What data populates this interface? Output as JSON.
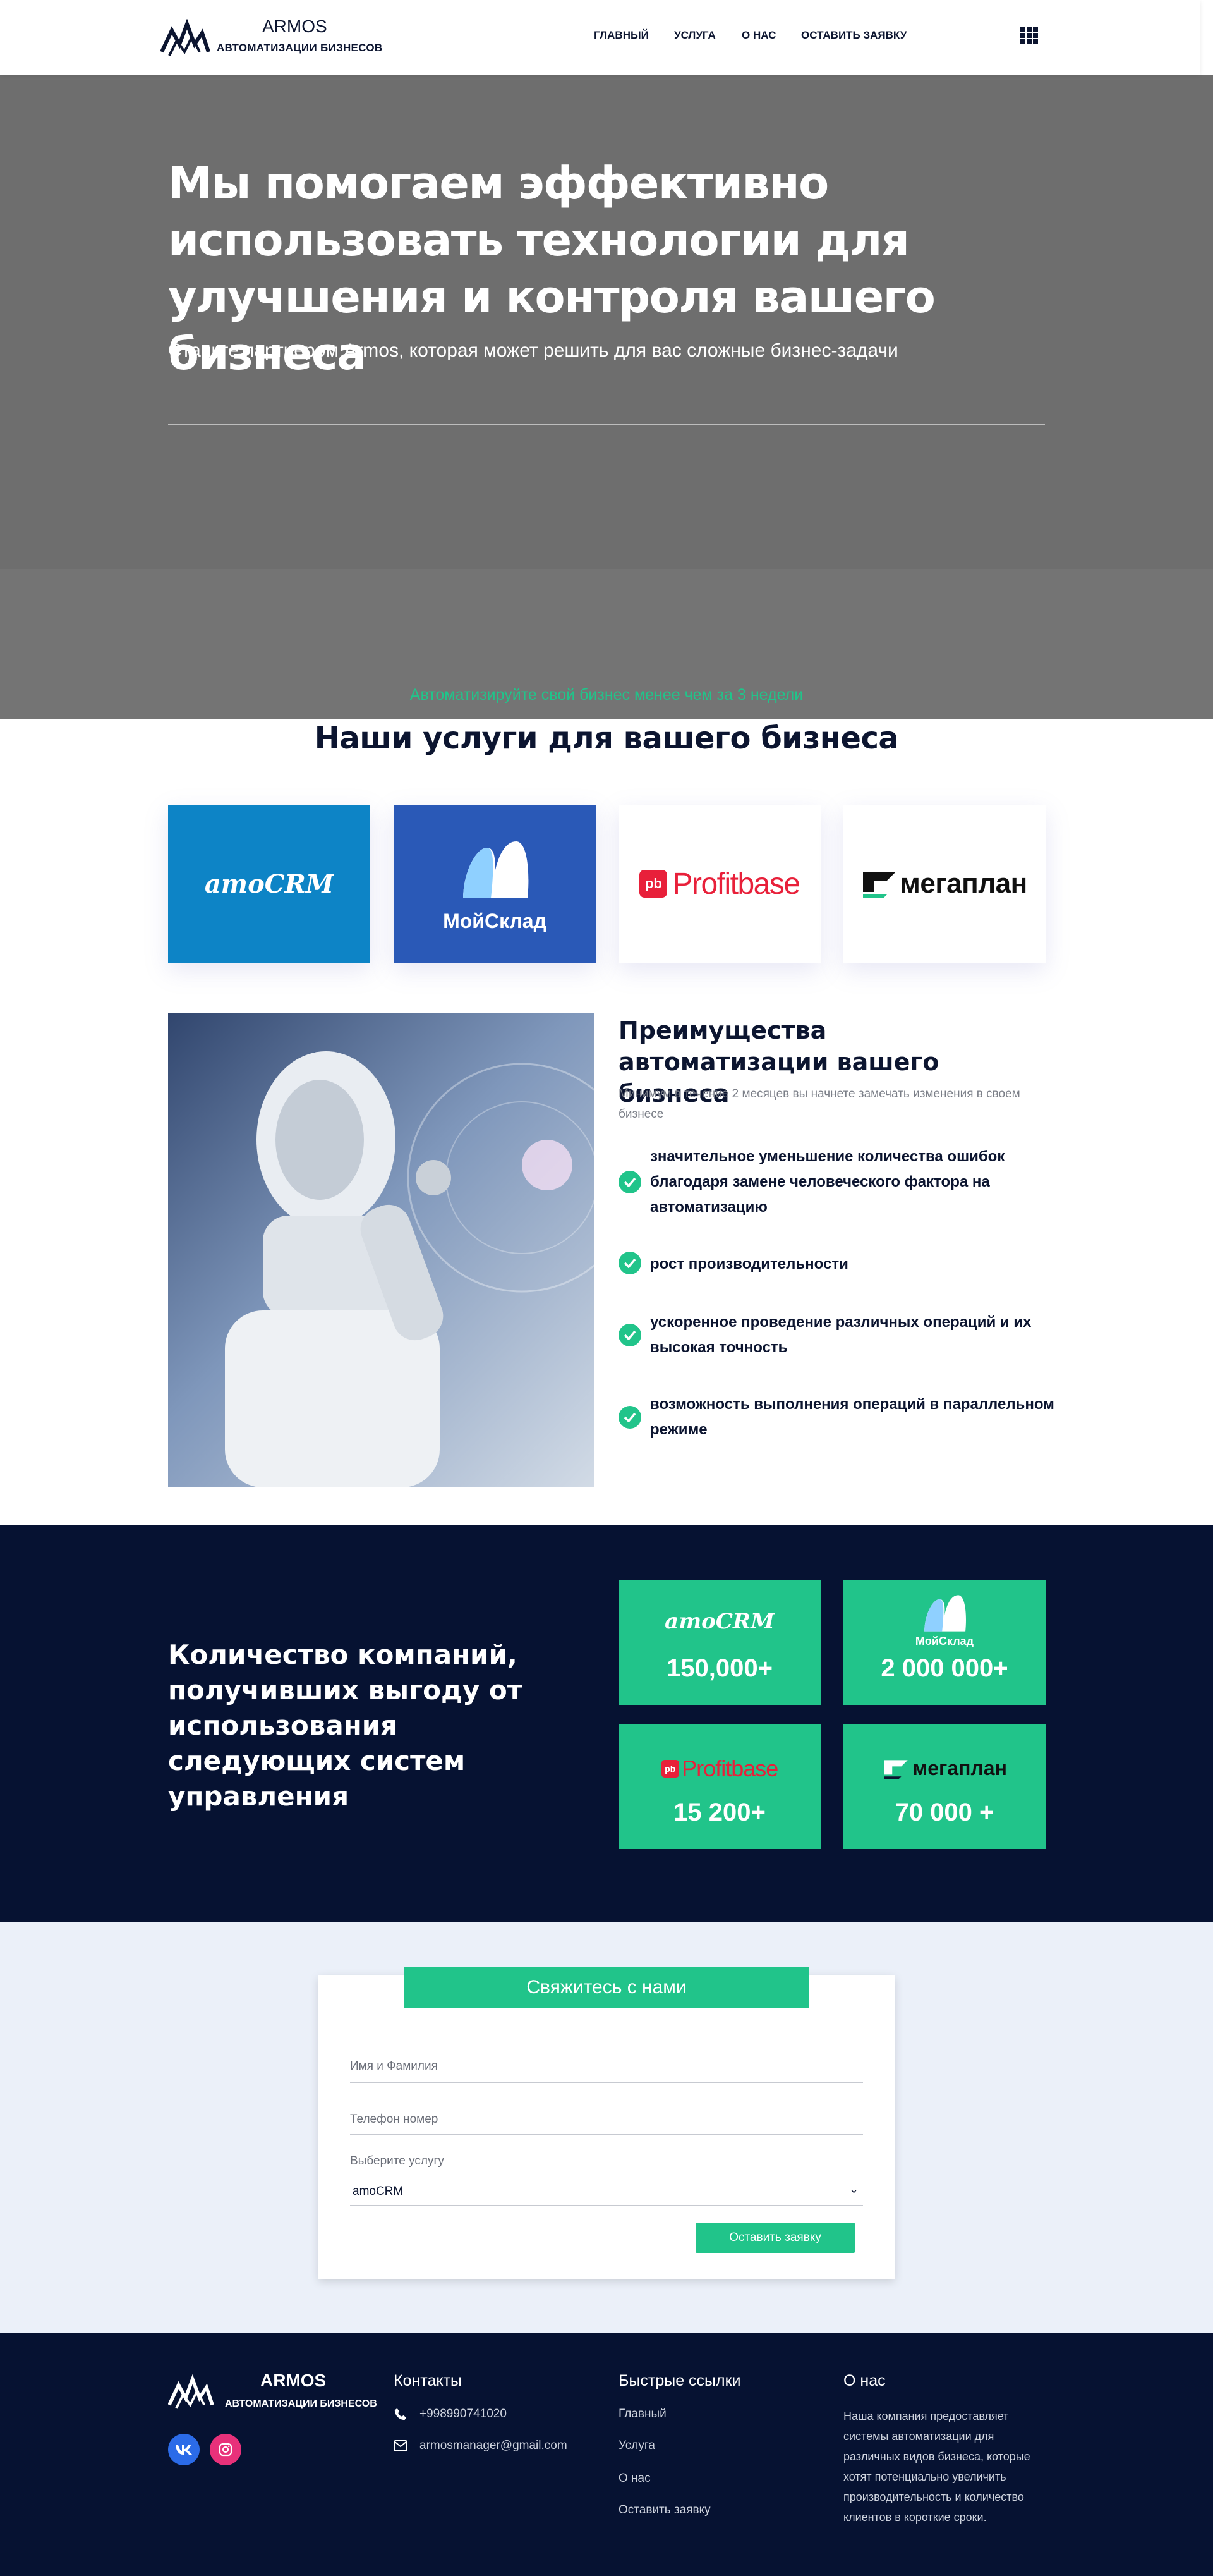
{
  "header": {
    "logo_name": "ARMOS",
    "logo_sub": "АВТОМАТИЗАЦИИ БИЗНЕСОВ",
    "nav": [
      "ГЛАВНЫЙ",
      "УСЛУГА",
      "О НАС",
      "ОСТАВИТЬ ЗАЯВКУ"
    ],
    "menu_icon": "grid-icon"
  },
  "hero": {
    "title": "Мы помогаем эффективно использовать технологии для улучшения и контроля вашего бизнеса",
    "subtitle": "Станьте партнером Armos, которая может решить для вас сложные бизнес-задачи"
  },
  "services": {
    "kicker": "Автоматизируйте свой бизнес менее чем за 3 недели",
    "title": "Наши услуги для вашего бизнеса",
    "cards": [
      {
        "name": "amoCRM",
        "color": "#0d84c6"
      },
      {
        "name": "МойСклад",
        "color": "#2a59b7"
      },
      {
        "name": "Profitbase",
        "badge": "pb",
        "color": "#e8203a"
      },
      {
        "name": "мегаплан",
        "color": "#111111"
      }
    ]
  },
  "benefits": {
    "title": "Преимущества автоматизации вашего бизнеса",
    "subtitle": "Минимум в течение 2 месяцев вы начнете замечать изменения в своем бизнесе",
    "items": [
      "значительное уменьшение количества ошибок благодаря замене человеческого фактора на автоматизацию",
      "рост производительности",
      "ускоренное проведение различных операций и их высокая точность",
      "возможность выполнения операций в параллельном режиме"
    ]
  },
  "stats": {
    "title": "Количество компаний, получивших выгоду от использования следующих систем управления",
    "items": [
      {
        "logo": "amoCRM",
        "value": "150,000+"
      },
      {
        "logo": "МойСклад",
        "value": "2 000 000+"
      },
      {
        "logo": "Profitbase",
        "badge": "pb",
        "value": "15 200+"
      },
      {
        "logo": "мегаплан",
        "value": "70 000 +"
      }
    ]
  },
  "contact": {
    "title": "Свяжитесь с нами",
    "name_placeholder": "Имя и Фамилия",
    "phone_placeholder": "Телефон номер",
    "service_label": "Выберите услугу",
    "service_value": "amoCRM",
    "submit": "Оставить заявку"
  },
  "footer": {
    "logo_name": "ARMOS",
    "logo_sub": "АВТОМАТИЗАЦИИ БИЗНЕСОВ",
    "social": [
      {
        "label": "VK",
        "icon": "vk-icon",
        "color": "#2b6be8"
      },
      {
        "label": "Instagram",
        "icon": "instagram-icon",
        "color": "#e8317a"
      }
    ],
    "contacts_title": "Контакты",
    "phone": "+998990741020",
    "email": "armosmanager@gmail.com",
    "links_title": "Быстрые ссылки",
    "links": [
      "Главный",
      "Услуга",
      "О нас",
      "Оставить заявку"
    ],
    "about_title": "О нас",
    "about_text": "Наша компания предоставляет системы автоматизации для различных видов бизнеса, которые хотят потенциально увеличить производительность и количество клиентов в короткие сроки."
  },
  "colors": {
    "accent": "#21c48a",
    "dark": "#061232",
    "hero_bg": "#6e6e6e",
    "contact_bg": "#ebf0f9"
  }
}
